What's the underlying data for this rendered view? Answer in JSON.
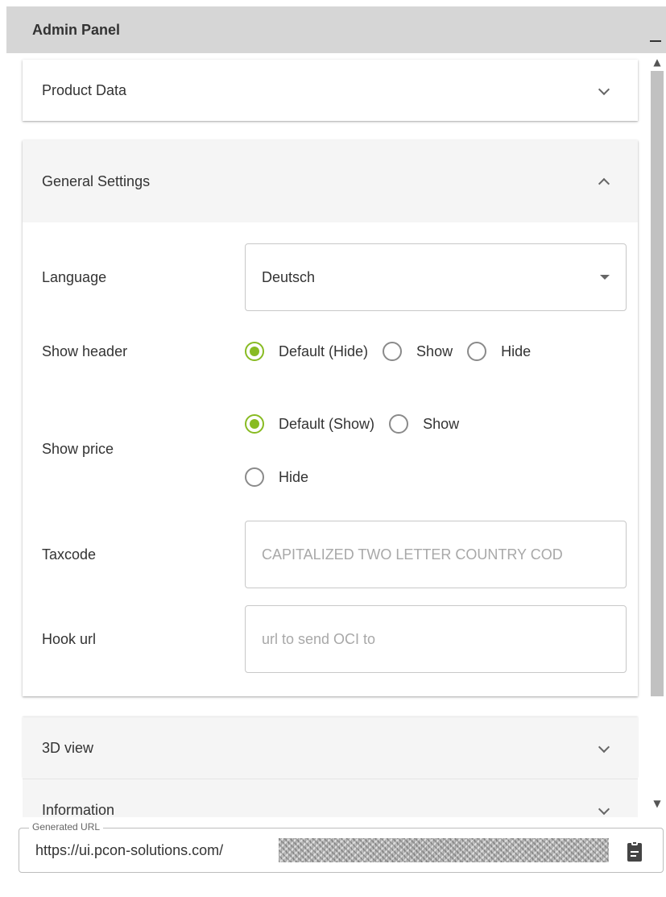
{
  "window": {
    "title": "Admin Panel"
  },
  "sections": {
    "product_data": {
      "label": "Product Data"
    },
    "general_settings": {
      "label": "General Settings",
      "language": {
        "label": "Language",
        "value": "Deutsch"
      },
      "show_header": {
        "label": "Show header",
        "options": [
          "Default (Hide)",
          "Show",
          "Hide"
        ],
        "selected": "Default (Hide)"
      },
      "show_price": {
        "label": "Show price",
        "options": [
          "Default (Show)",
          "Show",
          "Hide"
        ],
        "selected": "Default (Show)"
      },
      "taxcode": {
        "label": "Taxcode",
        "placeholder": "CAPITALIZED TWO LETTER COUNTRY COD"
      },
      "hook_url": {
        "label": "Hook url",
        "placeholder": "url to send OCI to"
      }
    },
    "view_3d": {
      "label": "3D view"
    },
    "information": {
      "label": "Information"
    }
  },
  "generated_url": {
    "legend": "Generated URL",
    "visible_prefix": "https://ui.pcon-solutions.com/"
  },
  "colors": {
    "accent": "#88bb22",
    "header_bg": "#d6d6d6",
    "panel_header_bg": "#f5f5f5"
  }
}
